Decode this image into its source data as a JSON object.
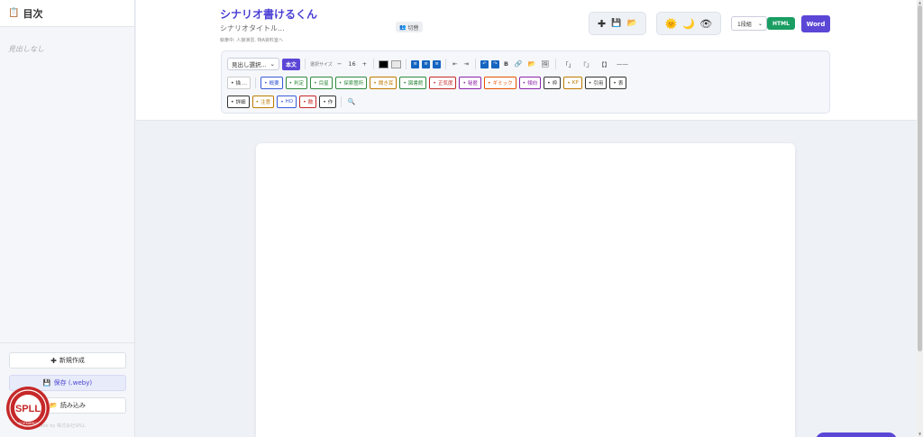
{
  "sidebar": {
    "title": "目次",
    "empty_text": "見出しなし",
    "new_label": "新規作成",
    "save_label": "保存 (.weby)",
    "load_label": "読み込み",
    "credit": "Made by 株式会社SPLL"
  },
  "header": {
    "title": "シナリオ書けるくん",
    "subtitle": "シナリオタイトル...",
    "status": "執筆中: 人狼演習, 特A資料室へ",
    "switch_label": "切替",
    "column_select": "1段組",
    "html_label": "HTML",
    "word_label": "Word"
  },
  "toolbar": {
    "heading_select": "見出し選択...",
    "body_label": "本文",
    "size_label": "選択サイズ",
    "size_minus": "−",
    "size_value": "16",
    "size_plus": "+",
    "indent_left": "⇤",
    "indent_right": "⇥",
    "bold": "B",
    "quote_open": "「」",
    "quote_double": "『』",
    "bracket": "【】",
    "dash": "——",
    "row2": [
      {
        "label": "描 ..."
      },
      {
        "label": "概要",
        "color": "#3b5bd6"
      },
      {
        "label": "判定",
        "color": "#2e8b3e"
      },
      {
        "label": "目星",
        "color": "#2e8b3e"
      },
      {
        "label": "探索箇所",
        "color": "#2e8b3e"
      },
      {
        "label": "聞き耳",
        "color": "#c07a00"
      },
      {
        "label": "図書館",
        "color": "#2e8b3e"
      },
      {
        "label": "正気度",
        "color": "#c62828"
      },
      {
        "label": "秘匿",
        "color": "#8e24aa"
      },
      {
        "label": "ギミック",
        "color": "#e65100"
      },
      {
        "label": "傾向",
        "color": "#8e24aa"
      },
      {
        "label": "枠",
        "color": "#333333"
      },
      {
        "label": "KP",
        "color": "#c07a00"
      },
      {
        "label": "引用",
        "color": "#333333"
      },
      {
        "label": "表",
        "color": "#333333"
      }
    ],
    "row3": [
      {
        "label": "詳細",
        "color": "#333333"
      },
      {
        "label": "注意",
        "color": "#c07a00"
      },
      {
        "label": "HO",
        "color": "#3b5bd6"
      },
      {
        "label": "敵",
        "color": "#c62828"
      },
      {
        "label": "作",
        "color": "#333333"
      }
    ]
  },
  "colors": {
    "accent": "#5a47d6",
    "html_button": "#1a9e63",
    "text_color_swatch": "#000000",
    "bg_color_swatch": "#e8e8e8"
  },
  "badge": {
    "text_top": "SPLL",
    "text_ring": "SCENARIO"
  }
}
